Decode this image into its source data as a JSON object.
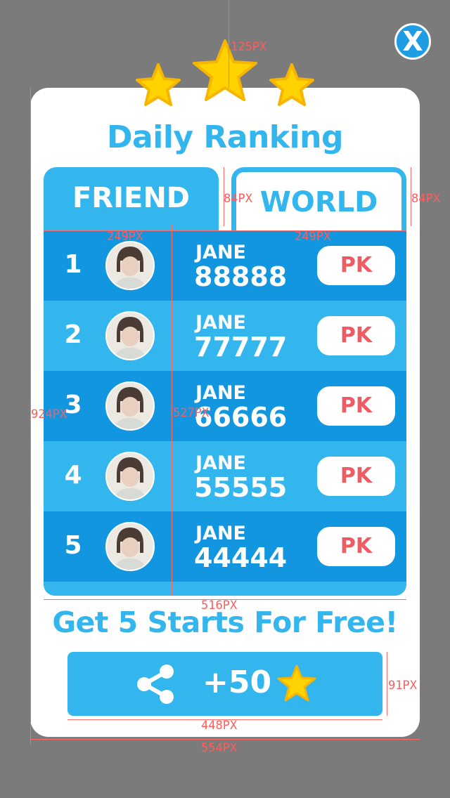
{
  "close": {
    "glyph": "X"
  },
  "title": "Daily Ranking",
  "tabs": {
    "friend": "FRIEND",
    "world": "WORLD"
  },
  "ranking": [
    {
      "rank": "1",
      "name": "JANE",
      "score": "88888",
      "action": "PK"
    },
    {
      "rank": "2",
      "name": "JANE",
      "score": "77777",
      "action": "PK"
    },
    {
      "rank": "3",
      "name": "JANE",
      "score": "66666",
      "action": "PK"
    },
    {
      "rank": "4",
      "name": "JANE",
      "score": "55555",
      "action": "PK"
    },
    {
      "rank": "5",
      "name": "JANE",
      "score": "44444",
      "action": "PK"
    }
  ],
  "promo": "Get 5 Starts For Free!",
  "share": {
    "label": "+50",
    "icon": "share-icon",
    "reward_icon": "star-icon"
  },
  "annotations": {
    "stars_offset": "125PX",
    "tab_height_left": "84PX",
    "tab_height_right": "84PX",
    "tab_width_left": "249PX",
    "tab_width_right": "249PX",
    "panel_height": "924PX",
    "list_height": "527PX",
    "list_width": "516PX",
    "button_height": "91PX",
    "button_width": "448PX",
    "panel_width": "554PX"
  },
  "colors": {
    "background": "#7b7b7b",
    "accent": "#33b6ee",
    "accent_dark": "#1296e0",
    "pk_text": "#f05a63",
    "star": "#ffd200"
  }
}
